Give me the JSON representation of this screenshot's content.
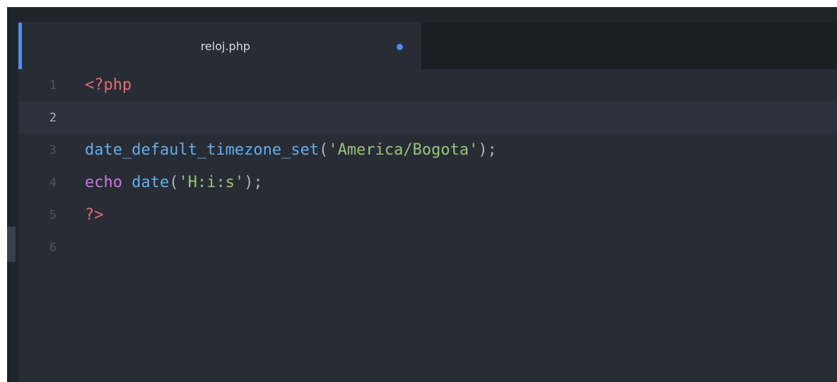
{
  "tab": {
    "title": "reloj.php",
    "modified_indicator": "modified-dot",
    "accent_color": "#568af2"
  },
  "editor": {
    "active_line": 2,
    "lines": [
      {
        "number": "1",
        "tokens": [
          "<?php"
        ]
      },
      {
        "number": "2",
        "tokens": []
      },
      {
        "number": "3",
        "tokens": [
          "date_default_timezone_set",
          "(",
          "'America/Bogota'",
          ");"
        ]
      },
      {
        "number": "4",
        "tokens": [
          "echo",
          " ",
          "date",
          "(",
          "'H:i:s'",
          ");"
        ]
      },
      {
        "number": "5",
        "tokens": [
          "?>"
        ]
      },
      {
        "number": "6",
        "tokens": []
      }
    ]
  },
  "colors": {
    "background": "#282c34",
    "php_tag": "#e06c75",
    "function": "#61afef",
    "keyword": "#c678dd",
    "string": "#98c379",
    "punctuation": "#abb2bf"
  }
}
